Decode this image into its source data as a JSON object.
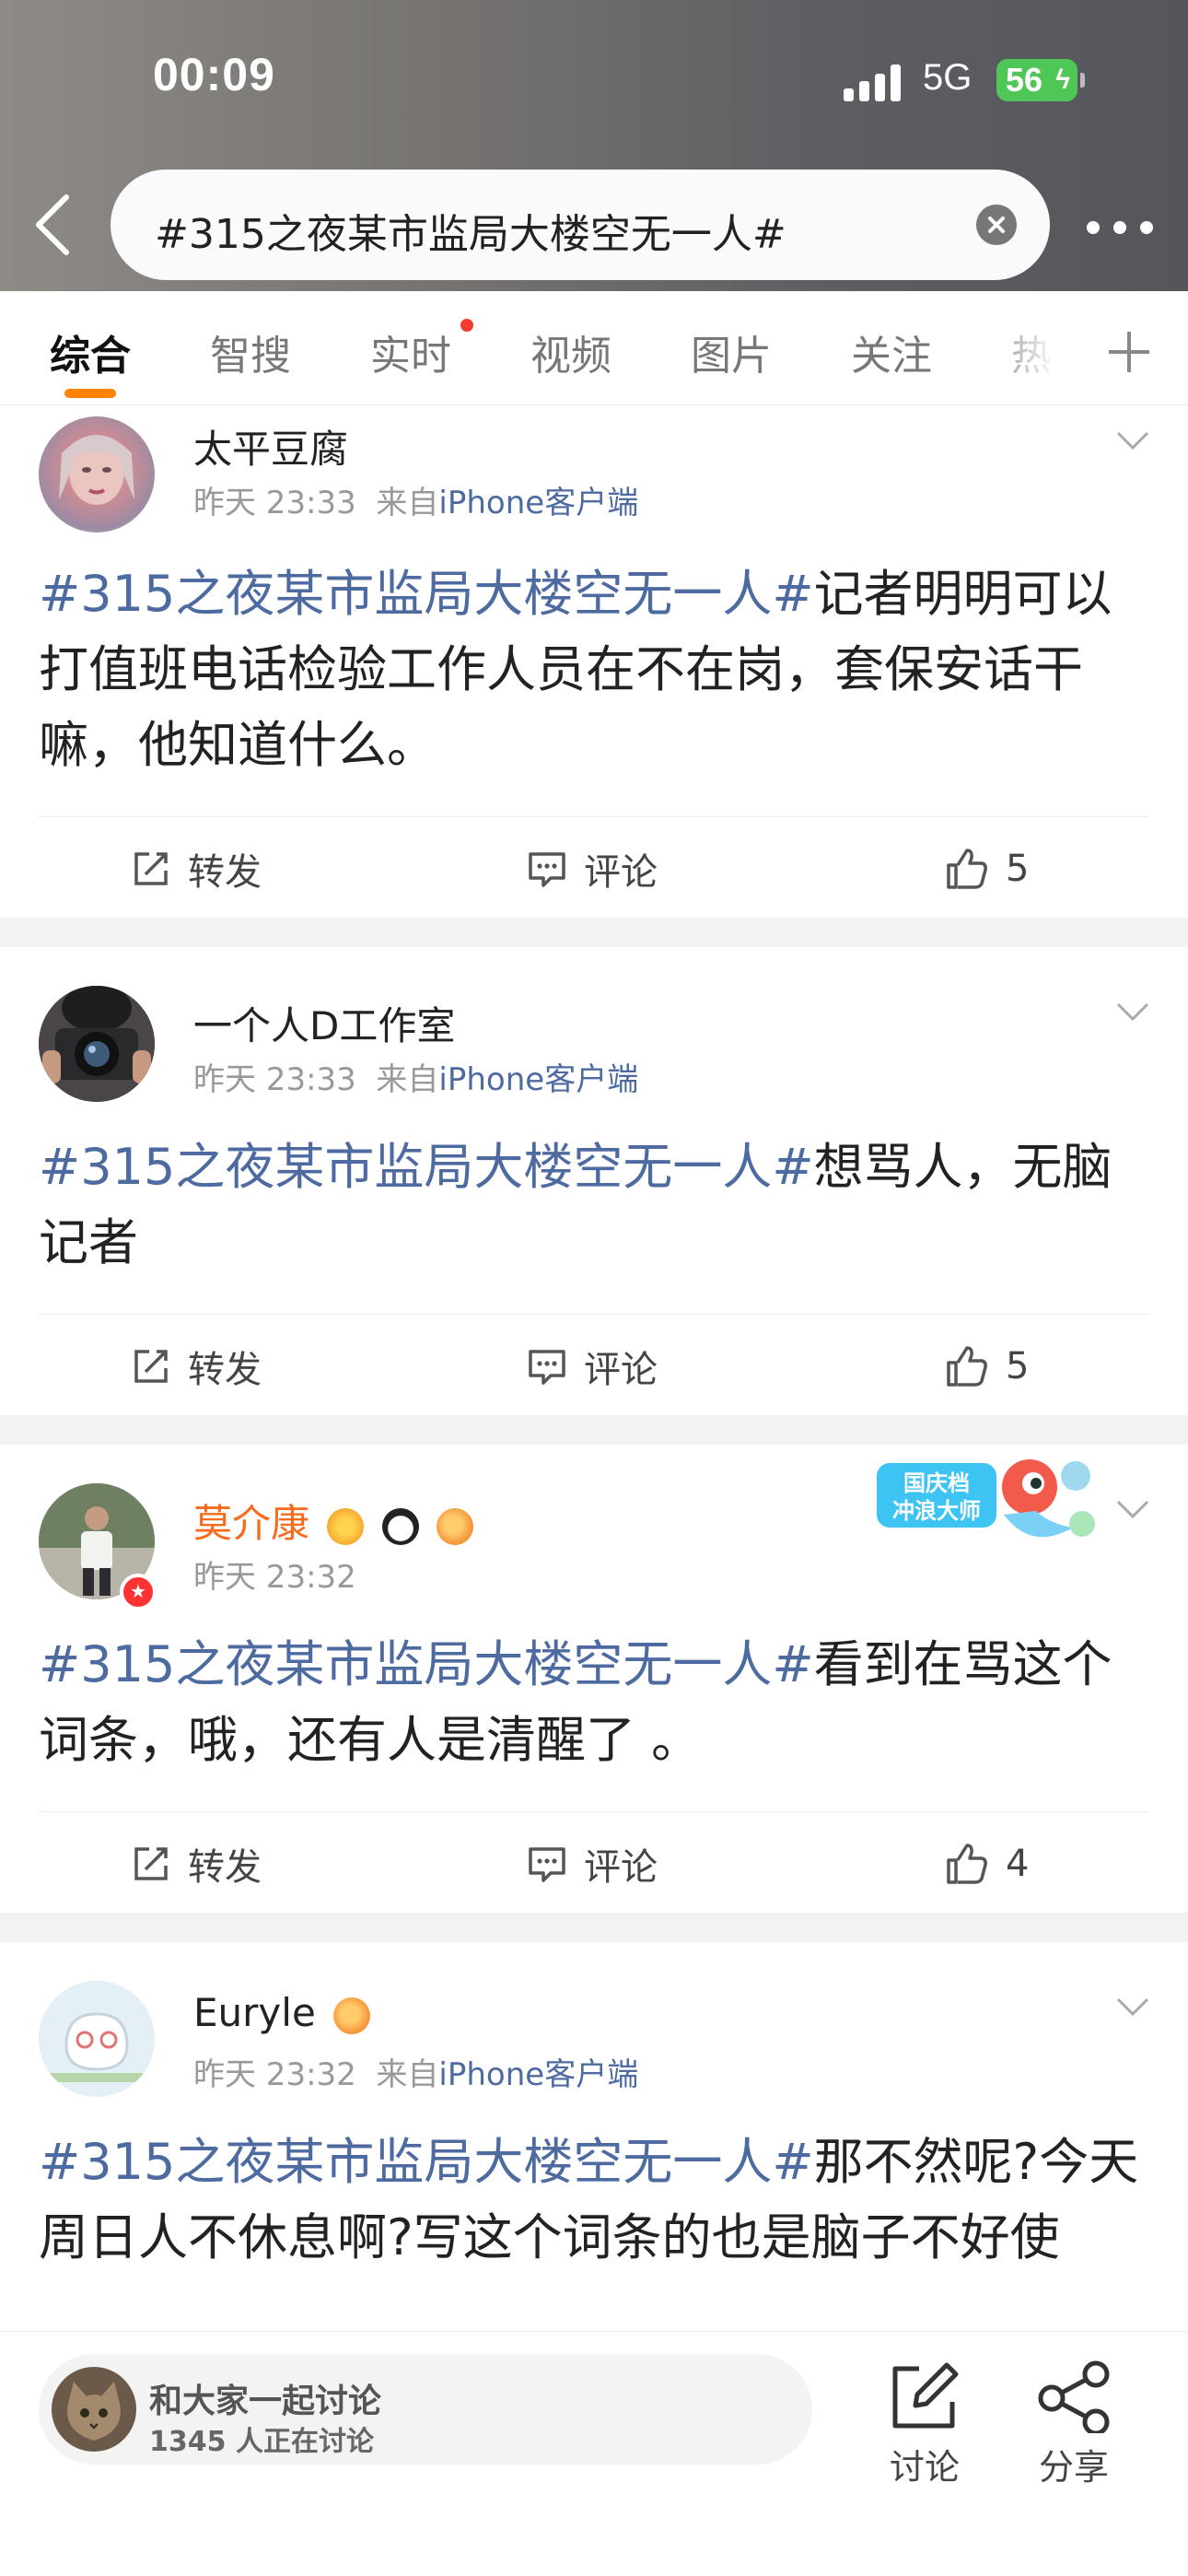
{
  "status_bar": {
    "time": "00:09",
    "network": "5G",
    "battery": "56"
  },
  "search": {
    "query": "#315之夜某市监局大楼空无一人#"
  },
  "tabs": [
    {
      "label": "综合",
      "active": true
    },
    {
      "label": "智搜"
    },
    {
      "label": "实时",
      "has_dot": true
    },
    {
      "label": "视频"
    },
    {
      "label": "图片"
    },
    {
      "label": "关注"
    },
    {
      "label": "热"
    }
  ],
  "posts": [
    {
      "username": "太平豆腐",
      "time": "昨天 23:33",
      "source_prefix": "来自",
      "source": "iPhone客户端",
      "topic": "#315之夜某市监局大楼空无一人#",
      "text": "记者明明可以打值班电话检验工作人员在不在岗，套保安话干嘛，他知道什么。",
      "repost_label": "转发",
      "comment_label": "评论",
      "likes": "5"
    },
    {
      "username": "一个人D工作室",
      "time": "昨天 23:33",
      "source_prefix": "来自",
      "source": "iPhone客户端",
      "topic": "#315之夜某市监局大楼空无一人#",
      "text": "想骂人，无脑记者",
      "repost_label": "转发",
      "comment_label": "评论",
      "likes": "5"
    },
    {
      "username": "莫介康",
      "time": "昨天 23:32",
      "topic": "#315之夜某市监局大楼空无一人#",
      "text": "看到在骂这个词条，哦，还有人是清醒了 。",
      "festival_badge_line1": "国庆档",
      "festival_badge_line2": "冲浪大师",
      "repost_label": "转发",
      "comment_label": "评论",
      "likes": "4"
    },
    {
      "username": "Euryle",
      "time": "昨天 23:32",
      "source_prefix": "来自",
      "source": "iPhone客户端",
      "topic": "#315之夜某市监局大楼空无一人#",
      "text": "那不然呢?今天周日人不休息啊?写这个词条的也是脑子不好使"
    }
  ],
  "bottom_bar": {
    "discussion_title": "和大家一起讨论",
    "discussion_count": "1345 人正在讨论",
    "discuss_label": "讨论",
    "share_label": "分享"
  },
  "colors": {
    "topic_link": "#4d6aa1",
    "accent_orange": "#ff8200",
    "vip_name": "#f86b1d"
  }
}
